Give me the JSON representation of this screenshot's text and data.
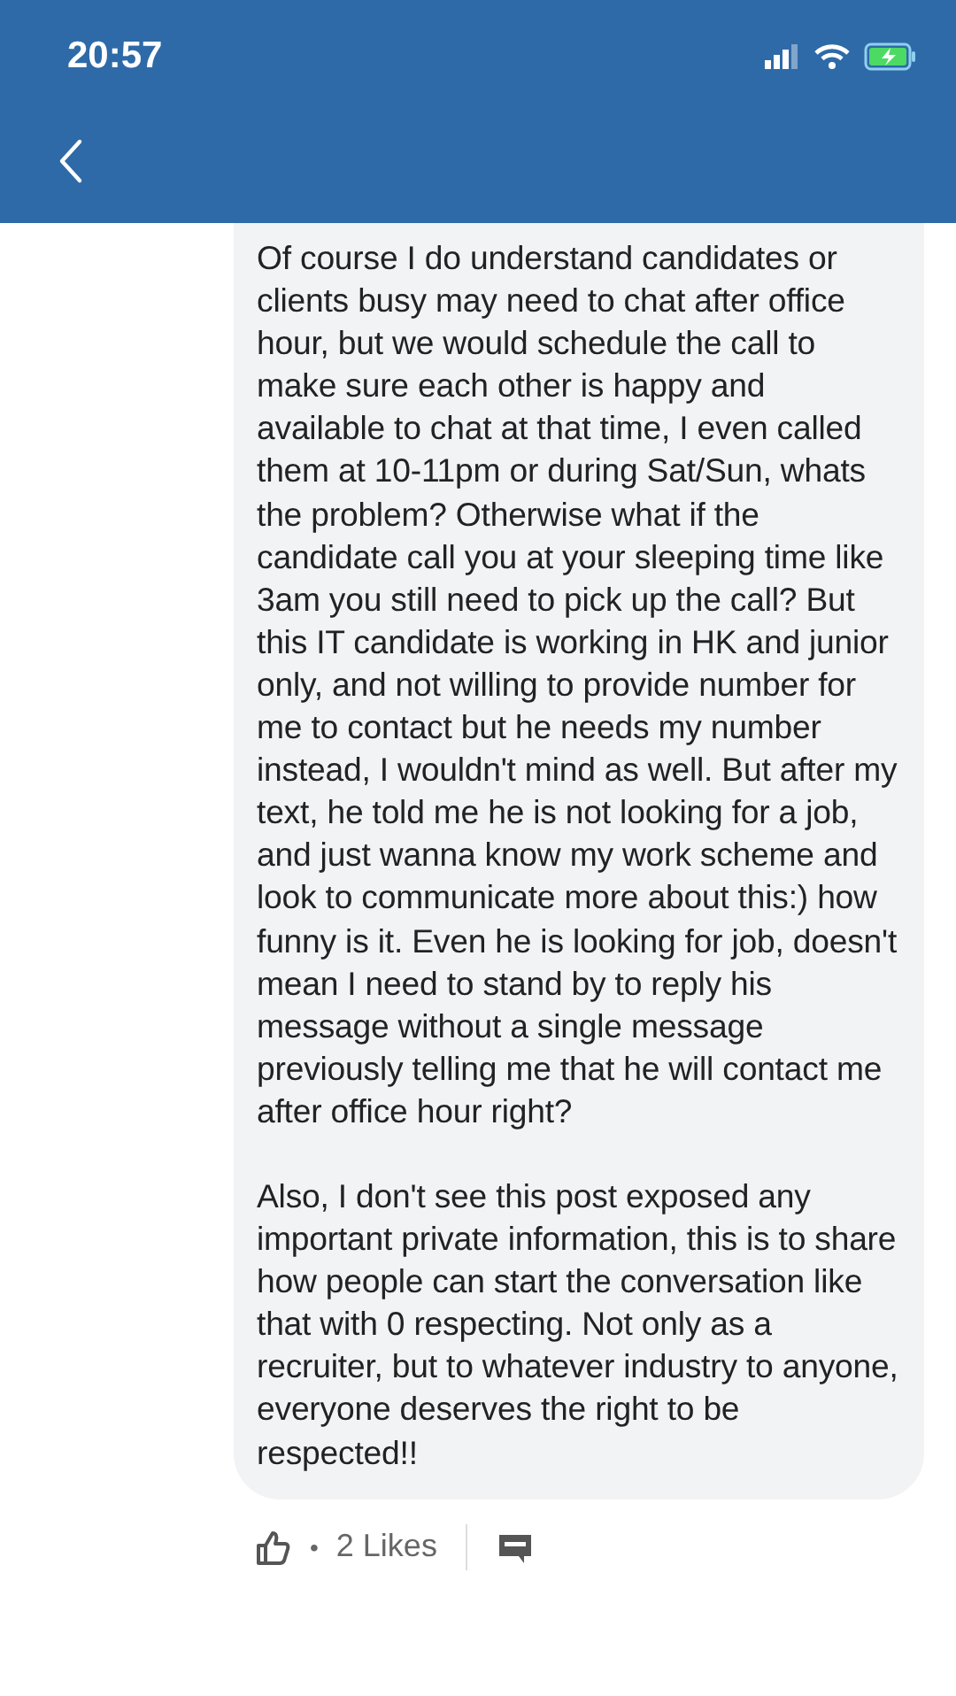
{
  "status_bar": {
    "time": "20:57"
  },
  "comment": {
    "paragraphs": [
      "Of course I do understand candidates or clients busy may need to chat after office hour, but we would schedule the call to make sure each other is happy and available to chat at that time, I even called them at 10-11pm or during Sat/Sun, whats the problem? Otherwise what if the candidate call you at your sleeping time like 3am you still need to pick up the call? But this IT candidate is working in HK and junior only, and not willing to provide number for me to contact but he needs my number instead, I wouldn't mind as well. But after my text, he told me he is not looking for a job, and just wanna know my work scheme and look to communicate more about this:) how funny is it. Even he is looking for job, doesn't mean I need to stand by to reply his message without a single message previously telling me that he will contact me after office hour right?",
      "Also, I don't see this post exposed any important private information, this is to share how people can start the conversation like that with 0 respecting. Not only as a recruiter, but to whatever industry to anyone, everyone deserves the right to be respected!!"
    ],
    "separator": "•",
    "likes": "2 Likes"
  }
}
